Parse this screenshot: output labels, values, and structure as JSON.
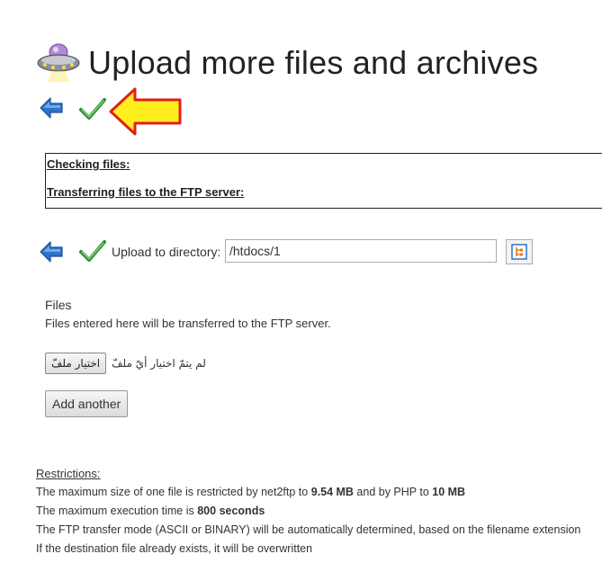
{
  "header": {
    "title": "Upload more files and archives",
    "logo_icon": "ufo-icon"
  },
  "nav_top": {
    "back_icon": "back-arrow-icon",
    "submit_icon": "checkmark-icon",
    "pointer_icon": "yellow-arrow-pointer-icon"
  },
  "status_box": {
    "checking_files": "Checking files:",
    "transferring_files": "Transferring files to the FTP server:"
  },
  "directory_row": {
    "label": "Upload to directory:",
    "value": "/htdocs/1",
    "tree_icon": "directory-tree-icon"
  },
  "files": {
    "heading": "Files",
    "description": "Files entered here will be transferred to the FTP server.",
    "choose_file_label": "اختيار ملفّ",
    "no_file_text": "لم يتمّ اختيار أيّ ملفّ",
    "add_another_label": "Add another"
  },
  "restrictions": {
    "title": "Restrictions:",
    "line1_pre": "The maximum size of one file is restricted by net2ftp to ",
    "line1_val1": "9.54 MB",
    "line1_mid": " and by PHP to ",
    "line1_val2": "10 MB",
    "line2_pre": "The maximum execution time is ",
    "line2_val": "800 seconds",
    "line3": "The FTP transfer mode (ASCII or BINARY) will be automatically determined, based on the filename extension",
    "line4": "If the destination file already exists, it will be overwritten"
  },
  "colors": {
    "back_arrow": "#2d73c9",
    "checkmark": "#3aa13a",
    "pointer_fill": "#ffef1f",
    "pointer_stroke": "#e0201a"
  }
}
